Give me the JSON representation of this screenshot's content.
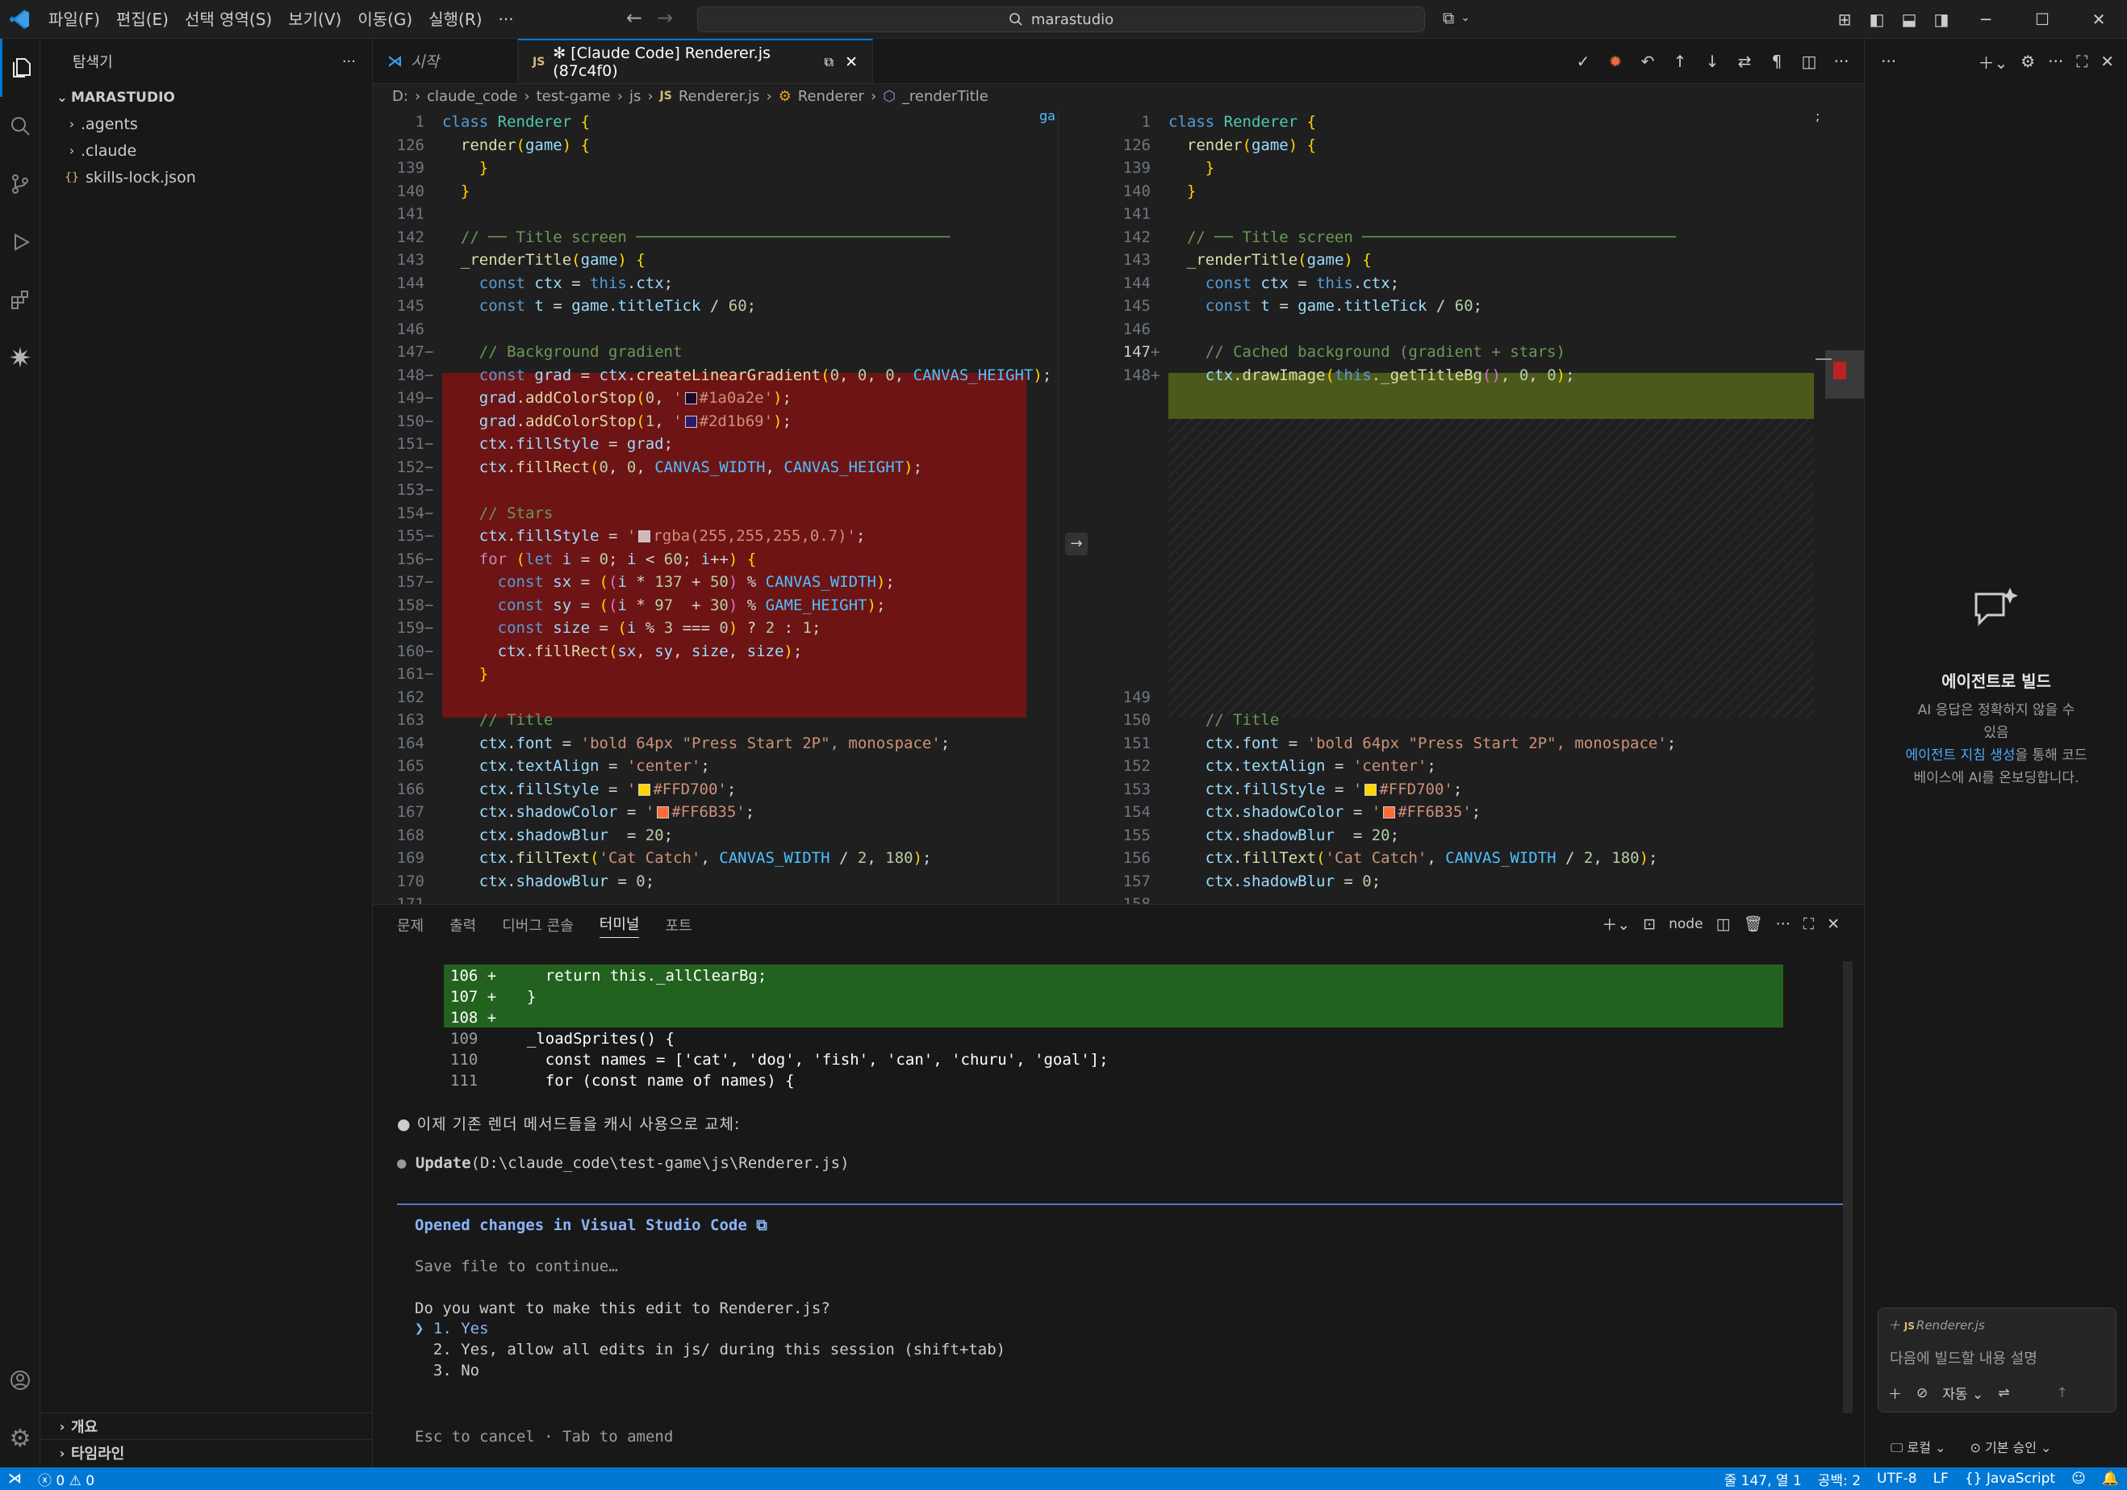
{
  "titlebar": {
    "menus": [
      "파일(F)",
      "편집(E)",
      "선택 영역(S)",
      "보기(V)",
      "이동(G)",
      "실행(R)",
      "···"
    ],
    "search": "marastudio"
  },
  "sidebar": {
    "title": "탐색기",
    "root": "MARASTUDIO",
    "items": [
      ".agents",
      ".claude",
      "skills-lock.json"
    ],
    "bottom": [
      "개요",
      "타임라인"
    ]
  },
  "tabs": [
    {
      "label": "시작"
    },
    {
      "label": "✻ [Claude Code] Renderer.js (87c4f0)"
    }
  ],
  "breadcrumb": [
    "D:",
    "claude_code",
    "test-game",
    "js",
    "Renderer.js",
    "Renderer",
    "_renderTitle"
  ],
  "left_pane": {
    "badge": "ga",
    "lines": [
      {
        "n": "1",
        "code": "class Renderer {"
      },
      {
        "n": "126",
        "code": "  render(game) {"
      },
      {
        "n": "139",
        "code": "    }"
      },
      {
        "n": "140",
        "code": "  }"
      },
      {
        "n": "141",
        "code": ""
      },
      {
        "n": "142",
        "code": "  // ── Title screen ──────────────────────────────────"
      },
      {
        "n": "143",
        "code": "  _renderTitle(game) {"
      },
      {
        "n": "144",
        "code": "    const ctx = this.ctx;"
      },
      {
        "n": "145",
        "code": "    const t = game.titleTick / 60;"
      },
      {
        "n": "146",
        "code": ""
      },
      {
        "n": "147",
        "code": "    // Background gradient"
      },
      {
        "n": "148",
        "code": "    const grad = ctx.createLinearGradient(0, 0, 0, CANVAS_HEIGHT);"
      },
      {
        "n": "149",
        "code": "    grad.addColorStop(0, '#1a0a2e');"
      },
      {
        "n": "150",
        "code": "    grad.addColorStop(1, '#2d1b69');"
      },
      {
        "n": "151",
        "code": "    ctx.fillStyle = grad;"
      },
      {
        "n": "152",
        "code": "    ctx.fillRect(0, 0, CANVAS_WIDTH, CANVAS_HEIGHT);"
      },
      {
        "n": "153",
        "code": ""
      },
      {
        "n": "154",
        "code": "    // Stars"
      },
      {
        "n": "155",
        "code": "    ctx.fillStyle = 'rgba(255,255,255,0.7)';"
      },
      {
        "n": "156",
        "code": "    for (let i = 0; i < 60; i++) {"
      },
      {
        "n": "157",
        "code": "      const sx = ((i * 137 + 50) % CANVAS_WIDTH);"
      },
      {
        "n": "158",
        "code": "      const sy = ((i * 97  + 30) % GAME_HEIGHT);"
      },
      {
        "n": "159",
        "code": "      const size = (i % 3 === 0) ? 2 : 1;"
      },
      {
        "n": "160",
        "code": "      ctx.fillRect(sx, sy, size, size);"
      },
      {
        "n": "161",
        "code": "    }"
      },
      {
        "n": "162",
        "code": ""
      },
      {
        "n": "163",
        "code": "    // Title"
      },
      {
        "n": "164",
        "code": "    ctx.font = 'bold 64px \"Press Start 2P\", monospace';"
      },
      {
        "n": "165",
        "code": "    ctx.textAlign = 'center';"
      },
      {
        "n": "166",
        "code": "    ctx.fillStyle = '#FFD700';"
      },
      {
        "n": "167",
        "code": "    ctx.shadowColor = '#FF6B35';"
      },
      {
        "n": "168",
        "code": "    ctx.shadowBlur  = 20;"
      },
      {
        "n": "169",
        "code": "    ctx.fillText('Cat Catch', CANVAS_WIDTH / 2, 180);"
      },
      {
        "n": "170",
        "code": "    ctx.shadowBlur = 0;"
      },
      {
        "n": "171",
        "code": ""
      }
    ]
  },
  "right_pane": {
    "badge": ";",
    "lines": [
      {
        "n": "1",
        "code": "class Renderer {"
      },
      {
        "n": "126",
        "code": "  render(game) {"
      },
      {
        "n": "139",
        "code": "    }"
      },
      {
        "n": "140",
        "code": "  }"
      },
      {
        "n": "141",
        "code": ""
      },
      {
        "n": "142",
        "code": "  // ── Title screen ──────────────────────────────────"
      },
      {
        "n": "143",
        "code": "  _renderTitle(game) {"
      },
      {
        "n": "144",
        "code": "    const ctx = this.ctx;"
      },
      {
        "n": "145",
        "code": "    const t = game.titleTick / 60;"
      },
      {
        "n": "146",
        "code": ""
      },
      {
        "n": "147",
        "code": "    // Cached background (gradient + stars)"
      },
      {
        "n": "148",
        "code": "    ctx.drawImage(this._getTitleBg(), 0, 0);"
      },
      {
        "n": "149",
        "code": ""
      },
      {
        "n": "150",
        "code": "    // Title"
      },
      {
        "n": "151",
        "code": "    ctx.font = 'bold 64px \"Press Start 2P\", monospace';"
      },
      {
        "n": "152",
        "code": "    ctx.textAlign = 'center';"
      },
      {
        "n": "153",
        "code": "    ctx.fillStyle = '#FFD700';"
      },
      {
        "n": "154",
        "code": "    ctx.shadowColor = '#FF6B35';"
      },
      {
        "n": "155",
        "code": "    ctx.shadowBlur  = 20;"
      },
      {
        "n": "156",
        "code": "    ctx.fillText('Cat Catch', CANVAS_WIDTH / 2, 180);"
      },
      {
        "n": "157",
        "code": "    ctx.shadowBlur = 0;"
      },
      {
        "n": "158",
        "code": ""
      }
    ]
  },
  "panel": {
    "tabs": [
      "문제",
      "출력",
      "디버그 콘솔",
      "터미널",
      "포트"
    ],
    "active_tab": "터미널",
    "shell": "node",
    "diff": [
      {
        "n": "106 +",
        "code": "    return this._allClearBg;"
      },
      {
        "n": "107 +",
        "code": "  }"
      },
      {
        "n": "108 +",
        "code": ""
      },
      {
        "n": "109",
        "code": "  _loadSprites() {"
      },
      {
        "n": "110",
        "code": "    const names = ['cat', 'dog', 'fish', 'can', 'churu', 'goal'];"
      },
      {
        "n": "111",
        "code": "    for (const name of names) {"
      }
    ],
    "msg1": "이제 기존 렌더 메서드들을 캐시 사용으로 교체:",
    "update_fn": "Update",
    "update_path": "(D:\\claude_code\\test-game\\js\\Renderer.js)",
    "opened": "Opened changes in Visual Studio Code ⧉",
    "save": "Save file to continue…",
    "question": "Do you want to make this edit to Renderer.js?",
    "options": [
      "1. Yes",
      "2. Yes, allow all edits in js/ during this session (shift+tab)",
      "3. No"
    ],
    "hint": "Esc to cancel · Tab to amend"
  },
  "chat": {
    "title": "에이전트로 빌드",
    "desc1": "AI 응답은 정확하지 않을 수",
    "desc2": "있음",
    "link": "에이전트 지침 생성",
    "desc3": "을 통해 코드",
    "desc4": "베이스에 AI를 온보딩합니다.",
    "context_file": "Renderer.js",
    "placeholder": "다음에 빌드할 내용 설명",
    "mode": "자동",
    "local": "로컬",
    "approve": "기본 승인"
  },
  "status": {
    "errors": "0",
    "warnings": "0",
    "position": "줄 147, 열 1",
    "spaces": "공백: 2",
    "encoding": "UTF-8",
    "eol": "LF",
    "lang": "JavaScript"
  }
}
